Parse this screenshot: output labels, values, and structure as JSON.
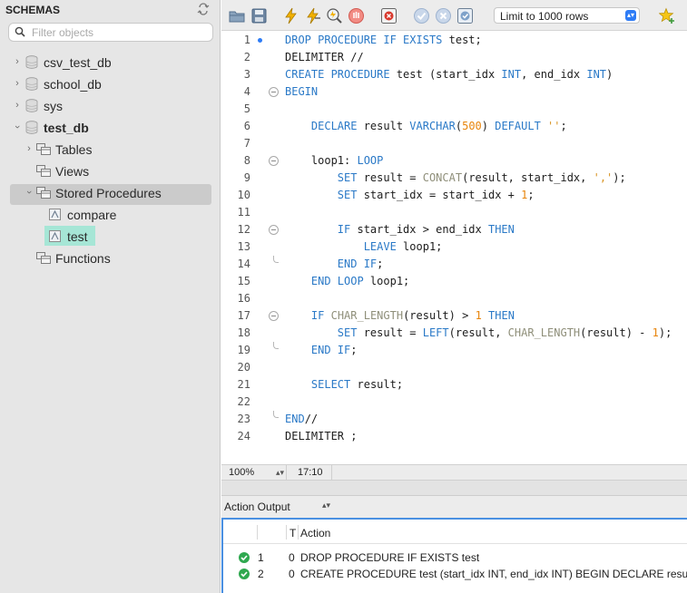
{
  "sidebar": {
    "title": "SCHEMAS",
    "filter_placeholder": "Filter objects",
    "schemas": [
      {
        "name": "csv_test_db",
        "expanded": false
      },
      {
        "name": "school_db",
        "expanded": false
      },
      {
        "name": "sys",
        "expanded": false
      },
      {
        "name": "test_db",
        "expanded": true
      }
    ],
    "test_db_children": {
      "tables": "Tables",
      "views": "Views",
      "stored_procedures": "Stored Procedures",
      "procedures": [
        "compare",
        "test"
      ],
      "functions": "Functions"
    },
    "selected_procedure": "test",
    "selection_color": "#a6e6d6"
  },
  "toolbar": {
    "icons": [
      "open-folder-icon",
      "save-icon",
      "execute-icon",
      "execute-selection-icon",
      "explain-icon",
      "stop-icon",
      "toggle-error-icon",
      "commit-icon",
      "rollback-icon",
      "autocommit-icon",
      "bookmark-icon"
    ],
    "limit_label": "Limit to 1000 rows"
  },
  "editor": {
    "lines": [
      {
        "n": "1",
        "html": "<span class=\"kw\">DROP PROCEDURE IF EXISTS</span> test;"
      },
      {
        "n": "2",
        "html": "DELIMITER //"
      },
      {
        "n": "3",
        "html": "<span class=\"kw\">CREATE PROCEDURE</span> test (start_idx <span class=\"kw\">INT</span>, end_idx <span class=\"kw\">INT</span>)"
      },
      {
        "n": "4",
        "html": "<span class=\"kw\">BEGIN</span>"
      },
      {
        "n": "5",
        "html": ""
      },
      {
        "n": "6",
        "html": "    <span class=\"kw\">DECLARE</span> result <span class=\"kw\">VARCHAR</span>(<span class=\"num\">500</span>) <span class=\"kw\">DEFAULT</span> <span class=\"str\">''</span>;"
      },
      {
        "n": "7",
        "html": ""
      },
      {
        "n": "8",
        "html": "    loop1: <span class=\"kw\">LOOP</span>"
      },
      {
        "n": "9",
        "html": "        <span class=\"kw\">SET</span> result = <span class=\"fn\">CONCAT</span>(result, start_idx, <span class=\"str\">','</span>);"
      },
      {
        "n": "10",
        "html": "        <span class=\"kw\">SET</span> start_idx = start_idx + <span class=\"num\">1</span>;"
      },
      {
        "n": "11",
        "html": ""
      },
      {
        "n": "12",
        "html": "        <span class=\"kw\">IF</span> start_idx > end_idx <span class=\"kw\">THEN</span>"
      },
      {
        "n": "13",
        "html": "            <span class=\"kw\">LEAVE</span> loop1;"
      },
      {
        "n": "14",
        "html": "        <span class=\"kw\">END IF</span>;"
      },
      {
        "n": "15",
        "html": "    <span class=\"kw\">END LOOP</span> loop1;"
      },
      {
        "n": "16",
        "html": ""
      },
      {
        "n": "17",
        "html": "    <span class=\"kw\">IF</span> <span class=\"fn\">CHAR_LENGTH</span>(result) > <span class=\"num\">1</span> <span class=\"kw\">THEN</span>"
      },
      {
        "n": "18",
        "html": "        <span class=\"kw\">SET</span> result = <span class=\"kw\">LEFT</span>(result, <span class=\"fn\">CHAR_LENGTH</span>(result) - <span class=\"num\">1</span>);"
      },
      {
        "n": "19",
        "html": "    <span class=\"kw\">END IF</span>;"
      },
      {
        "n": "20",
        "html": ""
      },
      {
        "n": "21",
        "html": "    <span class=\"kw\">SELECT</span> result;"
      },
      {
        "n": "22",
        "html": ""
      },
      {
        "n": "23",
        "html": "<span class=\"kw\">END</span>//"
      },
      {
        "n": "24",
        "html": "DELIMITER ;"
      }
    ],
    "fold_start_lines": [
      "4",
      "8",
      "12",
      "17"
    ],
    "fold_end_lines": [
      "14",
      "19",
      "23"
    ],
    "breakpoint_line": "1",
    "keyword_color": "#2a79c7",
    "number_color": "#e8850c"
  },
  "status": {
    "zoom": "100%",
    "cursor": "17:10"
  },
  "output": {
    "selector": "Action Output",
    "columns": {
      "time": "T",
      "action": "Action"
    },
    "rows": [
      {
        "num": "1",
        "t": "0",
        "action": "DROP PROCEDURE IF EXISTS test",
        "status": "success"
      },
      {
        "num": "2",
        "t": "0",
        "action": "CREATE PROCEDURE test (start_idx INT, end_idx INT) BEGIN   DECLARE result VA",
        "status": "success"
      }
    ]
  }
}
